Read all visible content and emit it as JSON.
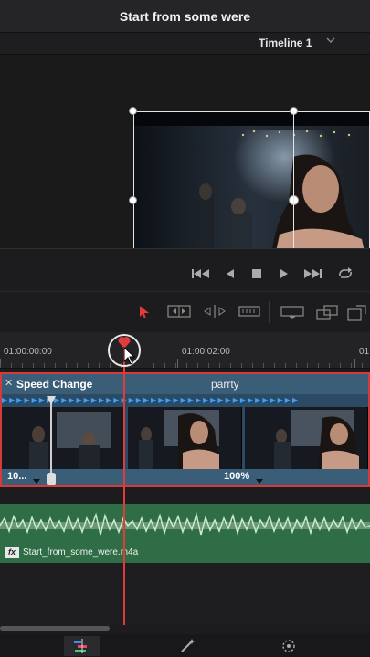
{
  "window": {
    "title": "Start from some were"
  },
  "timeline": {
    "name": "Timeline 1",
    "chevron_icon": "chevron-down-icon"
  },
  "transport": {
    "buttons": [
      "skip-to-start-icon",
      "play-reverse-icon",
      "stop-icon",
      "play-icon",
      "skip-to-end-icon",
      "loop-icon"
    ]
  },
  "toolbar": {
    "tools": [
      "selection-arrow-icon",
      "trim-edit-icon",
      "dynamic-trim-icon",
      "blade-icon",
      "overwrite-clip-icon",
      "replace-clip-icon",
      "insert-clip-icon"
    ],
    "active_color": "#e23b3b"
  },
  "ruler": {
    "timecodes": [
      "01:00:00:00",
      "01:00:02:00",
      "01"
    ]
  },
  "video_track": {
    "header_label": "Speed Change",
    "clip_name": "parrty",
    "close_icon": "close-icon",
    "speed_left": "10...",
    "speed_value": "100%",
    "border_color": "#d63a3a"
  },
  "audio_track": {
    "fx_label": "fx",
    "clip_name": "Start_from_some_were.m4a",
    "color": "#2e6d45"
  },
  "bottom_nav": {
    "items": [
      "edit-timeline-icon",
      "effects-wand-icon",
      "settings-dial-icon"
    ]
  }
}
